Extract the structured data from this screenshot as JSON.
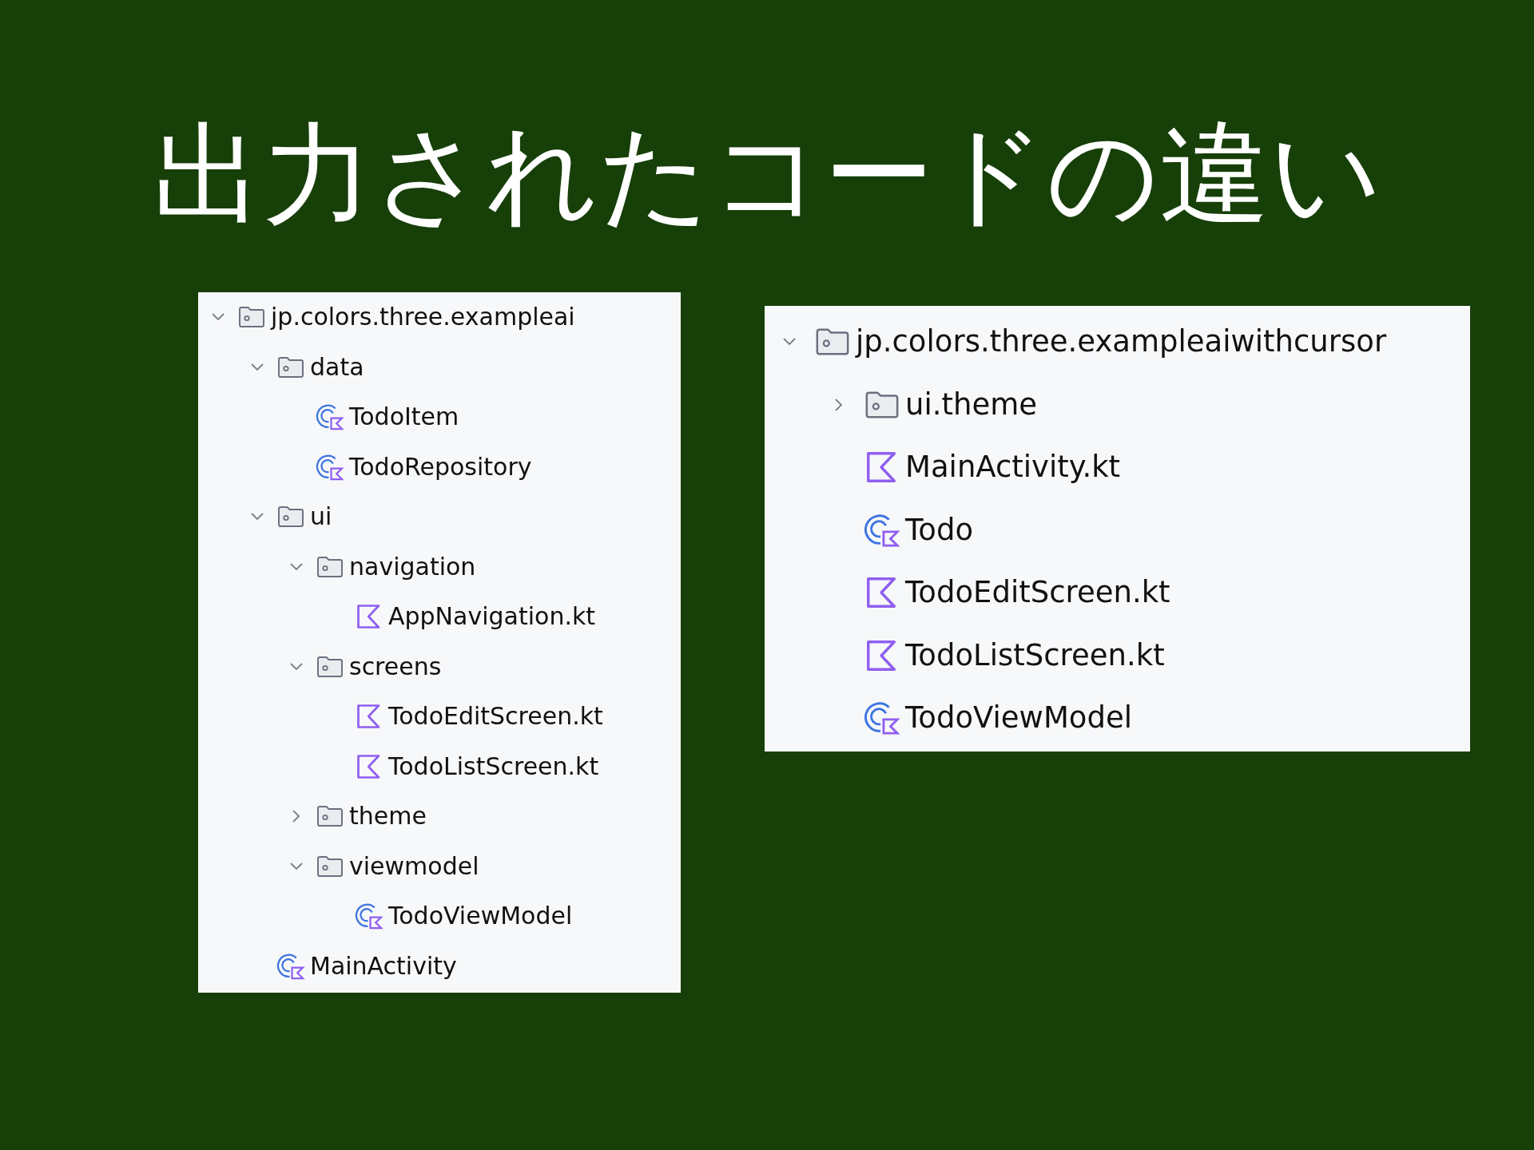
{
  "slide": {
    "title": "出力されたコードの違い"
  },
  "trees": [
    {
      "items": [
        {
          "kind": "folder",
          "label": "jp.colors.three.exampleai",
          "expanded": true,
          "children": [
            {
              "kind": "folder",
              "label": "data",
              "expanded": true,
              "children": [
                {
                  "kind": "class",
                  "label": "TodoItem"
                },
                {
                  "kind": "class",
                  "label": "TodoRepository"
                }
              ]
            },
            {
              "kind": "folder",
              "label": "ui",
              "expanded": true,
              "children": [
                {
                  "kind": "folder",
                  "label": "navigation",
                  "expanded": true,
                  "children": [
                    {
                      "kind": "file",
                      "label": "AppNavigation.kt"
                    }
                  ]
                },
                {
                  "kind": "folder",
                  "label": "screens",
                  "expanded": true,
                  "children": [
                    {
                      "kind": "file",
                      "label": "TodoEditScreen.kt"
                    },
                    {
                      "kind": "file",
                      "label": "TodoListScreen.kt"
                    }
                  ]
                },
                {
                  "kind": "folder",
                  "label": "theme",
                  "expanded": false
                },
                {
                  "kind": "folder",
                  "label": "viewmodel",
                  "expanded": true,
                  "children": [
                    {
                      "kind": "class",
                      "label": "TodoViewModel"
                    }
                  ]
                }
              ]
            },
            {
              "kind": "class",
              "label": "MainActivity"
            }
          ]
        }
      ]
    },
    {
      "items": [
        {
          "kind": "folder",
          "label": "jp.colors.three.exampleaiwithcursor",
          "expanded": true,
          "children": [
            {
              "kind": "folder",
              "label": "ui.theme",
              "expanded": false
            },
            {
              "kind": "file",
              "label": "MainActivity.kt"
            },
            {
              "kind": "class",
              "label": "Todo"
            },
            {
              "kind": "file",
              "label": "TodoEditScreen.kt"
            },
            {
              "kind": "file",
              "label": "TodoListScreen.kt"
            },
            {
              "kind": "class",
              "label": "TodoViewModel"
            }
          ]
        }
      ]
    }
  ]
}
